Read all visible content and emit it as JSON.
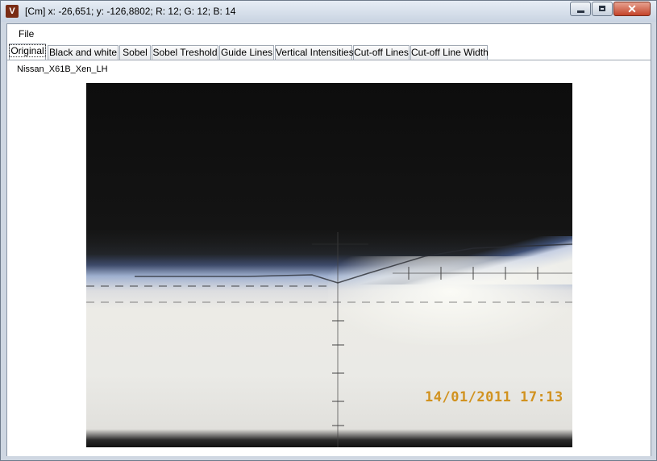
{
  "window": {
    "icon_letter": "V",
    "title": "[Cm] x: -26,651; y: -126,8802; R: 12; G: 12; B: 14",
    "close_glyph": "✕"
  },
  "menu": {
    "file": "File"
  },
  "tabs": [
    {
      "label": "Original",
      "active": true
    },
    {
      "label": "Black and white"
    },
    {
      "label": "Sobel"
    },
    {
      "label": "Sobel Treshold"
    },
    {
      "label": "Guide Lines"
    },
    {
      "label": "Vertical Intensities"
    },
    {
      "label": "Cut-off Lines"
    },
    {
      "label": "Cut-off Line Width"
    }
  ],
  "panel": {
    "file_name": "Nissan_X61B_Xen_LH",
    "image_timestamp": "14/01/2011  17:13"
  },
  "colors": {
    "timestamp": "#d1921f",
    "close_button": "#c4442a"
  },
  "icons": [
    "app-icon",
    "minimize-icon",
    "maximize-icon",
    "close-icon"
  ]
}
